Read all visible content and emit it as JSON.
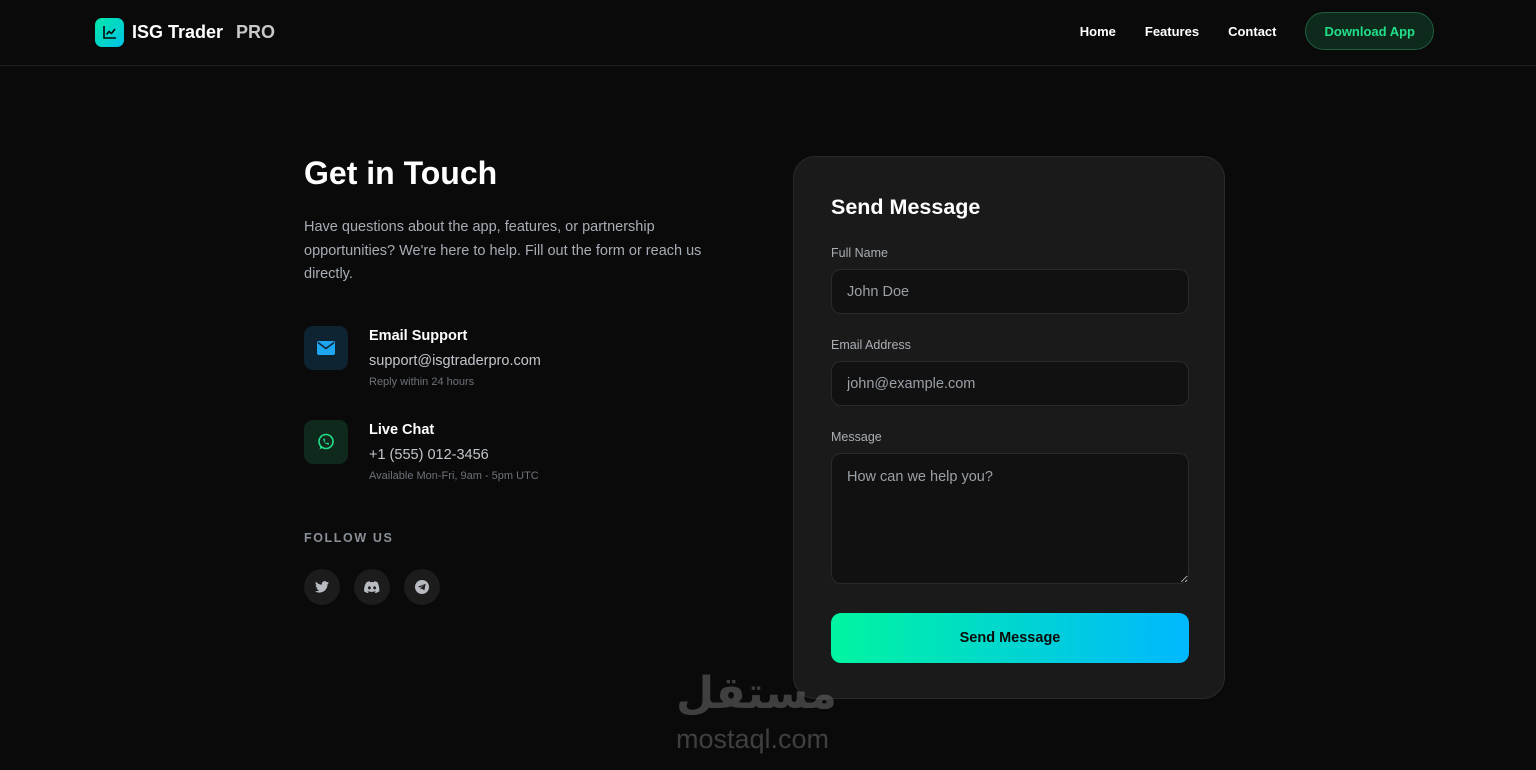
{
  "nav": {
    "brand_name": "ISG Trader",
    "brand_suffix": "PRO",
    "brand_icon": "chart-line-icon",
    "links": [
      {
        "label": "Home"
      },
      {
        "label": "Features"
      },
      {
        "label": "Contact"
      }
    ],
    "cta_label": "Download App"
  },
  "contact": {
    "title": "Get in Touch",
    "intro": "Have questions about the app, features, or partnership opportunities? We're here to help. Fill out the form or reach us directly.",
    "items": [
      {
        "icon": "envelope-icon",
        "title": "Email Support",
        "value": "support@isgtraderpro.com",
        "note": "Reply within 24 hours"
      },
      {
        "icon": "whatsapp-icon",
        "title": "Live Chat",
        "value": "+1 (555) 012-3456",
        "note": "Available Mon-Fri, 9am - 5pm UTC"
      }
    ],
    "follow_label": "FOLLOW US",
    "socials": [
      "twitter-icon",
      "discord-icon",
      "telegram-icon"
    ]
  },
  "form": {
    "title": "Send Message",
    "name_label": "Full Name",
    "name_placeholder": "John Doe",
    "email_label": "Email Address",
    "email_placeholder": "john@example.com",
    "message_label": "Message",
    "message_placeholder": "How can we help you?",
    "submit_label": "Send Message"
  },
  "watermark": {
    "arabic": "مستقل",
    "latin": "mostaql.com"
  },
  "colors": {
    "background": "#0a0a0a",
    "card": "#1a1a1a",
    "accent_green": "#22e08a",
    "gradient_start": "#00f5a0",
    "gradient_end": "#00b8ff"
  }
}
